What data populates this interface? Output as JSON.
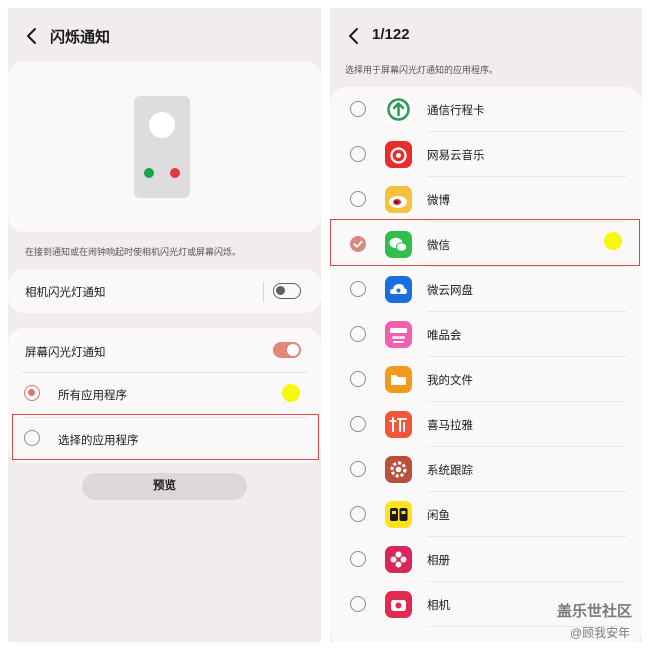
{
  "left": {
    "title": "闪烁通知",
    "caption": "在接到通知或在闹钟响起时使相机闪光灯或屏幕闪烁。",
    "camera_flash": {
      "label": "相机闪光灯通知",
      "enabled": false
    },
    "screen_flash": {
      "label": "屏幕闪光灯通知",
      "enabled": true
    },
    "options": [
      {
        "label": "所有应用程序",
        "selected": true
      },
      {
        "label": "选择的应用程序",
        "selected": false
      }
    ],
    "preview_label": "预览",
    "dot_colors": {
      "green": "#1aa14b",
      "red": "#e3393c"
    }
  },
  "right": {
    "title": "1/122",
    "caption": "选择用于屏幕闪光灯通知的应用程序。",
    "apps": [
      {
        "name": "通信行程卡",
        "icon": "travel-card-icon",
        "checked": false
      },
      {
        "name": "网易云音乐",
        "icon": "netease-music-icon",
        "checked": false
      },
      {
        "name": "微博",
        "icon": "weibo-icon",
        "checked": false
      },
      {
        "name": "微信",
        "icon": "wechat-icon",
        "checked": true
      },
      {
        "name": "微云网盘",
        "icon": "weiyun-icon",
        "checked": false
      },
      {
        "name": "唯品会",
        "icon": "vipshop-icon",
        "checked": false
      },
      {
        "name": "我的文件",
        "icon": "my-files-icon",
        "checked": false
      },
      {
        "name": "喜马拉雅",
        "icon": "ximalaya-icon",
        "checked": false
      },
      {
        "name": "系统跟踪",
        "icon": "system-trace-icon",
        "checked": false
      },
      {
        "name": "闲鱼",
        "icon": "xianyu-icon",
        "checked": false
      },
      {
        "name": "相册",
        "icon": "gallery-icon",
        "checked": false
      },
      {
        "name": "相机",
        "icon": "camera-icon",
        "checked": false
      }
    ]
  },
  "watermark": {
    "line1": "盖乐世社区",
    "line2": "@顾我安年"
  },
  "colors": {
    "accent": "#d9776a",
    "highlight": "#f8f70f",
    "annotation_box": "#d74a4a"
  }
}
